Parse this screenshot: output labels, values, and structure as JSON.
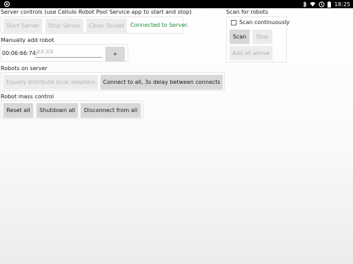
{
  "statusbar": {
    "time": "18:25",
    "icons": [
      "app-notification-icon",
      "bluetooth-icon",
      "wifi-icon",
      "alarm-icon",
      "battery-icon"
    ]
  },
  "server_controls": {
    "label": "Server controls (use Cellulo Robot Pool Service app to start and stop)",
    "start_label": "Start Server",
    "stop_label": "Stop Server",
    "clean_label": "Clean Socket",
    "status": "Connected to Server."
  },
  "scan": {
    "label": "Scan for robots",
    "continuous_label": "Scan continuously",
    "scan_label": "Scan",
    "stop_label": "Stop",
    "add_all_label": "Add all above"
  },
  "manual_add": {
    "label": "Manually add robot",
    "mac_prefix": "00:06:66:74:",
    "placeholder": "XX:XX",
    "add_label": "+"
  },
  "robots_on_server": {
    "label": "Robots on server",
    "distribute_label": "Equally distribute local adapters",
    "connect_all_label": "Connect to all, 3s delay between connects"
  },
  "mass_control": {
    "label": "Robot mass control",
    "reset_label": "Reset all",
    "shutdown_label": "Shutdown all",
    "disconnect_label": "Disconnect from all"
  },
  "colors": {
    "status_green": "#1e8c33",
    "button_bg": "#d8d8d8",
    "disabled_text": "#b3b3b3"
  }
}
